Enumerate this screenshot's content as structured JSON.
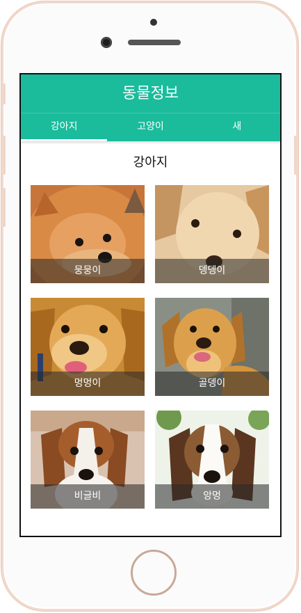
{
  "app": {
    "title": "동물정보"
  },
  "tabs": [
    {
      "label": "강아지",
      "active": true
    },
    {
      "label": "고양이",
      "active": false
    },
    {
      "label": "새",
      "active": false
    }
  ],
  "content": {
    "title": "강아지",
    "cards": [
      {
        "name": "뭉뭉이",
        "photo": "pomeranian-photo"
      },
      {
        "name": "뎅뎅이",
        "photo": "lab-puppy-photo"
      },
      {
        "name": "멍멍이",
        "photo": "golden-puppy-photo"
      },
      {
        "name": "골뎅이",
        "photo": "golden-smiling-photo"
      },
      {
        "name": "비글비",
        "photo": "beagle-photo"
      },
      {
        "name": "앙멍",
        "photo": "beagle-puppy-photo"
      }
    ]
  },
  "colors": {
    "accent": "#1abc9c",
    "caption_bg": "#282828"
  }
}
